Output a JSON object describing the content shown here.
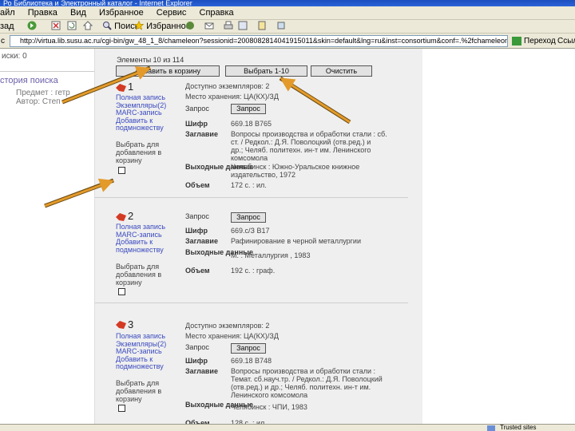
{
  "window": {
    "title": "Ро Библиотека и Электронный каталог - Internet Explorer"
  },
  "menu": [
    "айл",
    "Правка",
    "Вид",
    "Избранное",
    "Сервис",
    "Справка"
  ],
  "toolbar": {
    "back_label": "зад",
    "search_label": "Поиск",
    "favorites_label": "Избранное"
  },
  "address": {
    "label": "с",
    "url": "http://virtua.lib.susu.ac.ru/cgi-bin/gw_48_1_8/chameleon?sessionid=2008082814041915011&skin=default&lng=ru&inst=consortium&conf=.%2fchameleon.conf&host=loc",
    "go_label": "Переход",
    "links_label": "Ссылки"
  },
  "left": {
    "results_label": "иски: 0",
    "history_title": "стория поиска",
    "history_item1": "Предмет : гетр",
    "history_item2": "Автор: Степ"
  },
  "results": {
    "range_label": "Элементы 10 из 114",
    "add_to_cart_label": "Добавить в корзину",
    "select_range_label": "Выбрать 1-10",
    "clear_label": "Очистить"
  },
  "records": [
    {
      "num": "1",
      "links": "Полная запись\nЭкземпляры(2)\nMARC-запись\nДобавить к\nподмножеству",
      "select_label": "Выбрать для\nдобавления в\nкорзину",
      "holdings_label": "Доступно экземпляров: 2",
      "location_label": "Место хранения: ЦА(КХ)/ЗД",
      "request_label": "Запрос",
      "request_button": "Запрос",
      "shifr_label": "Шифр",
      "shifr_value": "669.18 В765",
      "title_label": "Заглавие",
      "title_value": "Вопросы производства и обработки стали : сб.\nст. / Редкол.: Д.Я. Поволоцкий (отв.ред.) и\nдр.; Челяб. политехн. ин-т им. Ленинского\nкомсомола",
      "pub_label": "Выходные\nданные",
      "pub_value": "Челябинск : Южно-Уральское книжное\nиздательство, 1972",
      "volume_label": "Объем",
      "volume_value": "172 с. : ил."
    },
    {
      "num": "2",
      "links": "Полная запись\nMARC-запись\nДобавить к\nподмножеству",
      "select_label": "Выбрать для\nдобавления в\nкорзину",
      "request_label": "Запрос",
      "request_button": "Запрос",
      "shifr_label": "Шифр",
      "shifr_value": "669.с/З В17",
      "title_label": "Заглавие",
      "title_value": "Рафинирование в черной металлургии",
      "pub_label": "Выходные\nданные",
      "pub_value": "М. : Металлургия , 1983",
      "volume_label": "Объем",
      "volume_value": "192 с. : граф."
    },
    {
      "num": "3",
      "links": "Полная запись\nЭкземпляры(2)\nMARC-запись\nДобавить к\nподмножеству",
      "select_label": "Выбрать для\nдобавления в\nкорзину",
      "holdings_label": "Доступно экземпляров: 2",
      "location_label": "Место хранения: ЦА(КХ)/ЗД",
      "request_label": "Запрос",
      "request_button": "Запрос",
      "shifr_label": "Шифр",
      "shifr_value": "669.18 В748",
      "title_label": "Заглавие",
      "title_value": "Вопросы производства и обработки стали :\nТемат. сб.науч.тр. / Редкол.: Д.Я. Поволоцкий\n(отв.ред.) и др.; Челяб. политехн. ин-т им.\nЛенинского комсомола",
      "pub_label": "Выходные\nданные",
      "pub_value": "Челябинск : ЧПИ, 1983",
      "volume_label": "Объем",
      "volume_value": "128 с. : ил."
    }
  ],
  "status": {
    "zone_label": "Trusted sites"
  },
  "colors": {
    "content_bg": "#efefef",
    "annotation_arrow": "#e39a2a",
    "link": "#3b4bbf",
    "pin": "#d33a24"
  }
}
